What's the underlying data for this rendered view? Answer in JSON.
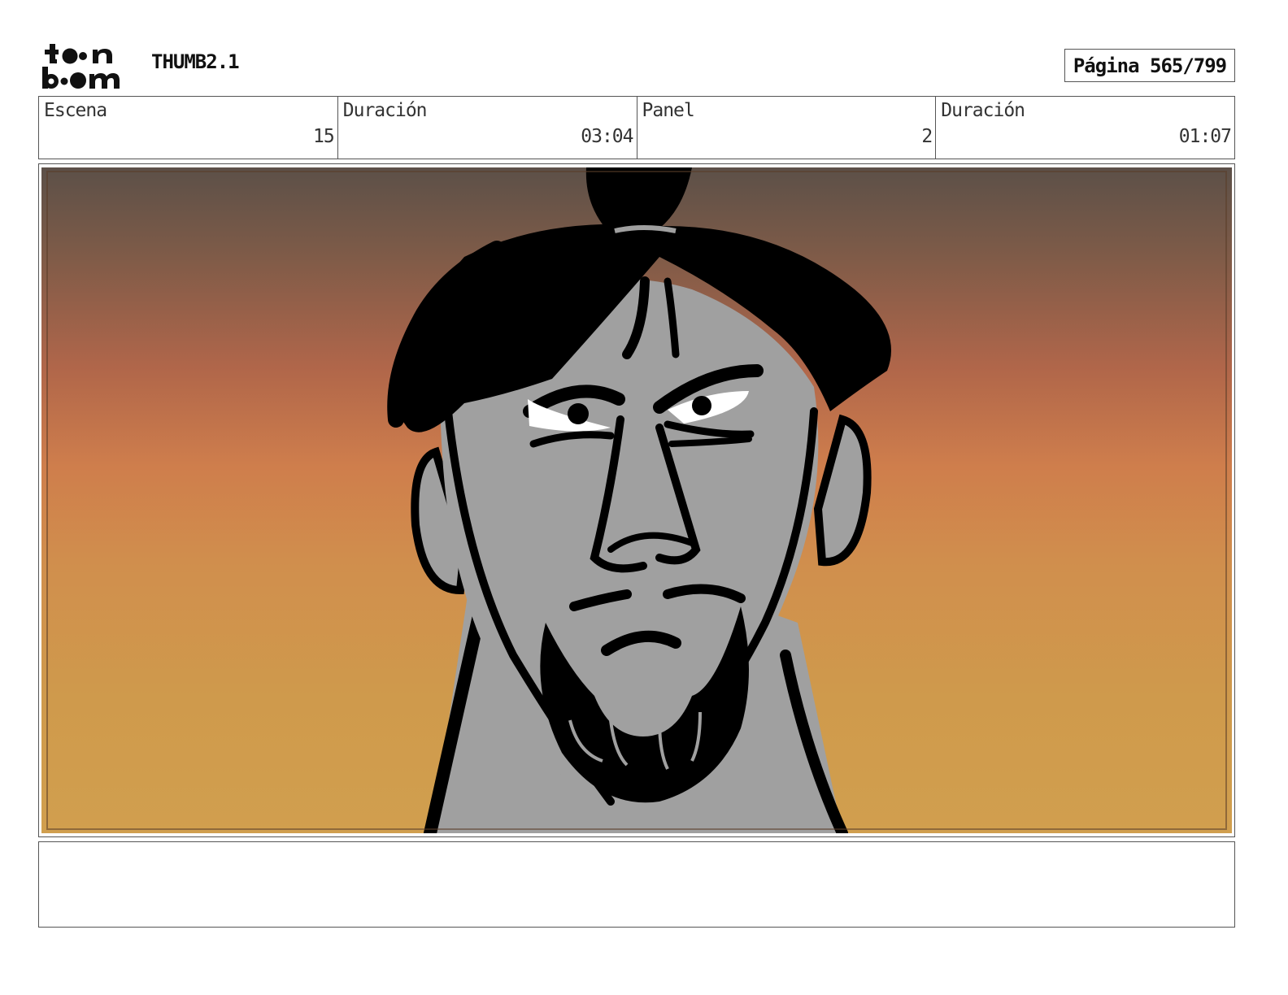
{
  "header": {
    "logo_text": "toon boom",
    "title": "THUMB2.1",
    "page_label": "Página 565/799"
  },
  "info": {
    "scene_label": "Escena",
    "scene_value": "15",
    "scene_duration_label": "Duración",
    "scene_duration_value": "03:04",
    "panel_label": "Panel",
    "panel_value": "2",
    "panel_duration_label": "Duración",
    "panel_duration_value": "01:07"
  },
  "notes": {
    "text": ""
  }
}
